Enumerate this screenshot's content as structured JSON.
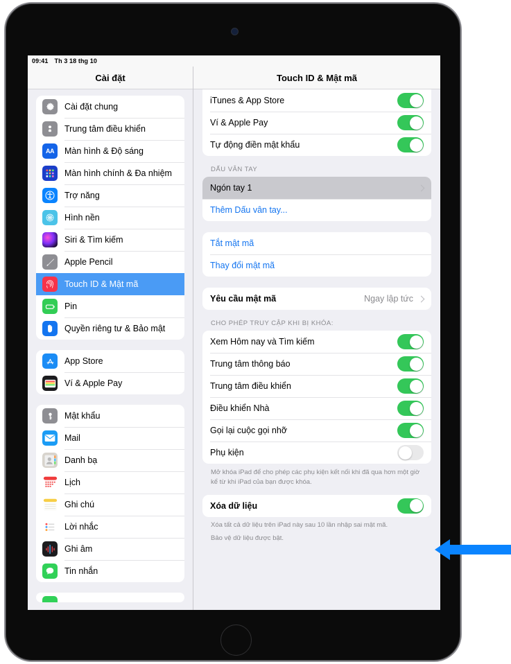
{
  "statusbar": {
    "time": "09:41",
    "date": "Th 3 18 thg 10"
  },
  "sidebar": {
    "title": "Cài đặt",
    "groups": [
      {
        "items": [
          {
            "label": "Cài đặt chung",
            "icon": "gear-icon"
          },
          {
            "label": "Trung tâm điều khiển",
            "icon": "control-center-icon"
          },
          {
            "label": "Màn hình & Độ sáng",
            "icon": "display-brightness-icon"
          },
          {
            "label": "Màn hình chính & Đa nhiệm",
            "icon": "home-screen-icon"
          },
          {
            "label": "Trợ năng",
            "icon": "accessibility-icon"
          },
          {
            "label": "Hình nền",
            "icon": "wallpaper-icon"
          },
          {
            "label": "Siri & Tìm kiếm",
            "icon": "siri-icon"
          },
          {
            "label": "Apple Pencil",
            "icon": "apple-pencil-icon"
          },
          {
            "label": "Touch ID & Mật mã",
            "icon": "touch-id-icon",
            "selected": true
          },
          {
            "label": "Pin",
            "icon": "battery-icon"
          },
          {
            "label": "Quyền riêng tư & Bảo mật",
            "icon": "privacy-hand-icon"
          }
        ]
      },
      {
        "items": [
          {
            "label": "App Store",
            "icon": "app-store-icon"
          },
          {
            "label": "Ví & Apple Pay",
            "icon": "wallet-icon"
          }
        ]
      },
      {
        "items": [
          {
            "label": "Mật khẩu",
            "icon": "passwords-key-icon"
          },
          {
            "label": "Mail",
            "icon": "mail-icon"
          },
          {
            "label": "Danh bạ",
            "icon": "contacts-icon"
          },
          {
            "label": "Lịch",
            "icon": "calendar-icon"
          },
          {
            "label": "Ghi chú",
            "icon": "notes-icon"
          },
          {
            "label": "Lời nhắc",
            "icon": "reminders-icon"
          },
          {
            "label": "Ghi âm",
            "icon": "voice-memos-icon"
          },
          {
            "label": "Tin nhắn",
            "icon": "messages-icon"
          }
        ]
      }
    ]
  },
  "content": {
    "title": "Touch ID & Mật mã",
    "group_touchid_uses": [
      {
        "label": "iTunes & App Store",
        "toggle": "on"
      },
      {
        "label": "Ví & Apple Pay",
        "toggle": "on"
      },
      {
        "label": "Tự động điền mật khẩu",
        "toggle": "on"
      }
    ],
    "fingerprint_header": "DẤU VÂN TAY",
    "fingerprints": [
      {
        "label": "Ngón tay 1",
        "chevron": true,
        "highlight": true
      },
      {
        "label": "Thêm Dấu vân tay...",
        "link": true
      }
    ],
    "passcode_actions": [
      {
        "label": "Tắt mật mã",
        "link": true
      },
      {
        "label": "Thay đổi mật mã",
        "link": true
      }
    ],
    "require_passcode": {
      "label": "Yêu cầu mật mã",
      "value": "Ngay lập tức",
      "chevron": true
    },
    "locked_access_header": "CHO PHÉP TRUY CẬP KHI BỊ KHÓA:",
    "locked_access": [
      {
        "label": "Xem Hôm nay và Tìm kiếm",
        "toggle": "on"
      },
      {
        "label": "Trung tâm thông báo",
        "toggle": "on"
      },
      {
        "label": "Trung tâm điều khiển",
        "toggle": "on"
      },
      {
        "label": "Điều khiển Nhà",
        "toggle": "on"
      },
      {
        "label": "Gọi lại cuộc gọi nhỡ",
        "toggle": "on"
      },
      {
        "label": "Phụ kiện",
        "toggle": "off"
      }
    ],
    "accessories_footer": "Mở khóa iPad để cho phép các phụ kiện kết nối khi đã qua hơn một giờ kể từ khi iPad của bạn được khóa.",
    "erase_data": {
      "label": "Xóa dữ liệu",
      "toggle": "on"
    },
    "erase_footer_1": "Xóa tất cả dữ liệu trên iPad này sau 10 lần nhập sai mật mã.",
    "erase_footer_2": "Bảo vệ dữ liệu được bật."
  },
  "annotation": {
    "arrow": "left-pointing-arrow",
    "color": "#0a84ff"
  },
  "colors": {
    "accent_blue": "#1475f0",
    "selection_blue": "#4a9bf5",
    "toggle_on_green": "#34c759",
    "toggle_off_gray": "#e9e9ea",
    "screen_background": "#efeff4"
  }
}
